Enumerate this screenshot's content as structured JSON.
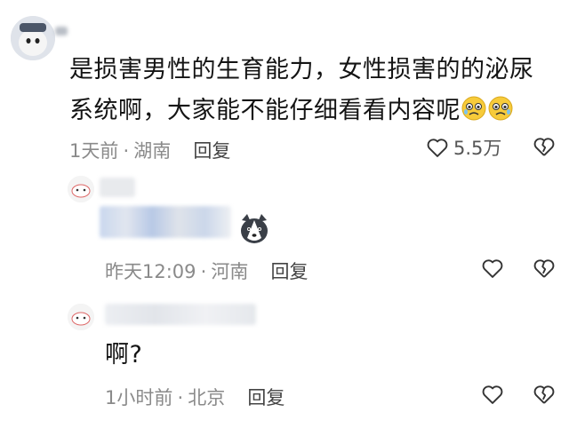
{
  "main_comment": {
    "line1": "是损害男性的生育能力，女性损害的的泌尿",
    "line2": "系统啊，大家能不能仔细看看内容呢",
    "emoji": [
      "anxious-face-emoji",
      "anxious-face-emoji"
    ],
    "time": "1天前",
    "location": "湖南",
    "separator": "·",
    "reply_label": "回复",
    "like_count": "5.5万"
  },
  "reply1": {
    "time": "昨天12:09",
    "location": "河南",
    "separator": "·",
    "reply_label": "回复",
    "sticker": "husky-dog-sticker"
  },
  "reply2": {
    "text": "啊?",
    "time": "1小时前",
    "location": "北京",
    "separator": "·",
    "reply_label": "回复"
  },
  "colors": {
    "meta_text": "#8a8a8a",
    "body_text": "#141414",
    "icon_stroke": "#333333"
  }
}
